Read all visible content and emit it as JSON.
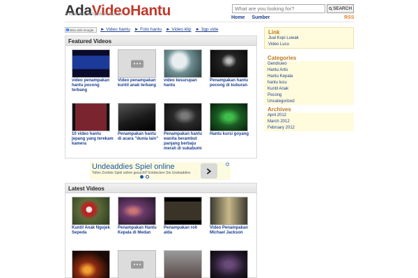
{
  "header": {
    "logo_part1": "Ada",
    "logo_part2": "VideoHantu",
    "tagline": "Video Penampakan Hantu",
    "search_placeholder": "What are you looking for?",
    "search_button": "SEARCH",
    "nav": [
      "Home",
      "Sumber"
    ],
    "rss": "RSS"
  },
  "translate_label": "Bisa oleh Google",
  "category_links": [
    "Video hantu",
    "Foto hantu",
    "Video klip",
    "3gp vide"
  ],
  "featured": {
    "heading": "Featured Videos",
    "items": [
      {
        "title": "video penampakan hantu pocong terbang",
        "thumb": "dark-blue-screen"
      },
      {
        "title": "Video penampakan kuntil anak terbang",
        "thumb": "placeholder"
      },
      {
        "title": "video kesurupan hantu",
        "thumb": "teal-room"
      },
      {
        "title": "Penampakan hantu pocong di kuburan",
        "thumb": "dark-night"
      },
      {
        "title": "10 video hantu jepang yang terekam kamera",
        "thumb": "japanese-screen"
      },
      {
        "title": "Penampakan hantu di acara \"dunia lain\"",
        "thumb": "dark-stairs"
      },
      {
        "title": "Penampakan hantu wanita berambut panjang berbaju merah di sukabumi",
        "thumb": "dark-figure"
      },
      {
        "title": "Hantu kursi goyang",
        "thumb": "green-night"
      }
    ]
  },
  "ad": {
    "title": "Undeaddies Spiel online",
    "text": "Tolles Zombie Spiel online gesucht? Entdecken Sie Undeaddies"
  },
  "latest": {
    "heading": "Latest Videos",
    "items": [
      {
        "title": "Kuntil Anak Ngojek Sepeda",
        "thumb": "red-figure"
      },
      {
        "title": "Penampakan Hantu Kepala di Medan",
        "thumb": "purple-scene"
      },
      {
        "title": "Penampakan roh alda",
        "thumb": "dark-tv"
      },
      {
        "title": "Video Penampakan Michael Jackson",
        "thumb": "hallway"
      },
      {
        "title": "",
        "thumb": "fire"
      },
      {
        "title": "",
        "thumb": "placeholder"
      },
      {
        "title": "",
        "thumb": "grey-room"
      },
      {
        "title": "",
        "thumb": "dark-purple"
      }
    ]
  },
  "sidebar": {
    "link": {
      "heading": "Link",
      "items": [
        "Jual Kopi Luwak",
        "Video Lucu"
      ]
    },
    "categories": {
      "heading": "Categories",
      "items": [
        "Gendruwo",
        "Hantu Artis",
        "Hantu Kepala",
        "hantu lucu",
        "Kuntil Anak",
        "Pocong",
        "Uncategorized"
      ]
    },
    "archives": {
      "heading": "Archives",
      "items": [
        "April 2012",
        "March 2012",
        "February 2012"
      ]
    }
  },
  "colors": {
    "brand_red": "#c0392b",
    "link_blue": "#1a3d8f",
    "sidebar_heading": "#c0781b",
    "sidebar_bg": "#fffbdc"
  }
}
